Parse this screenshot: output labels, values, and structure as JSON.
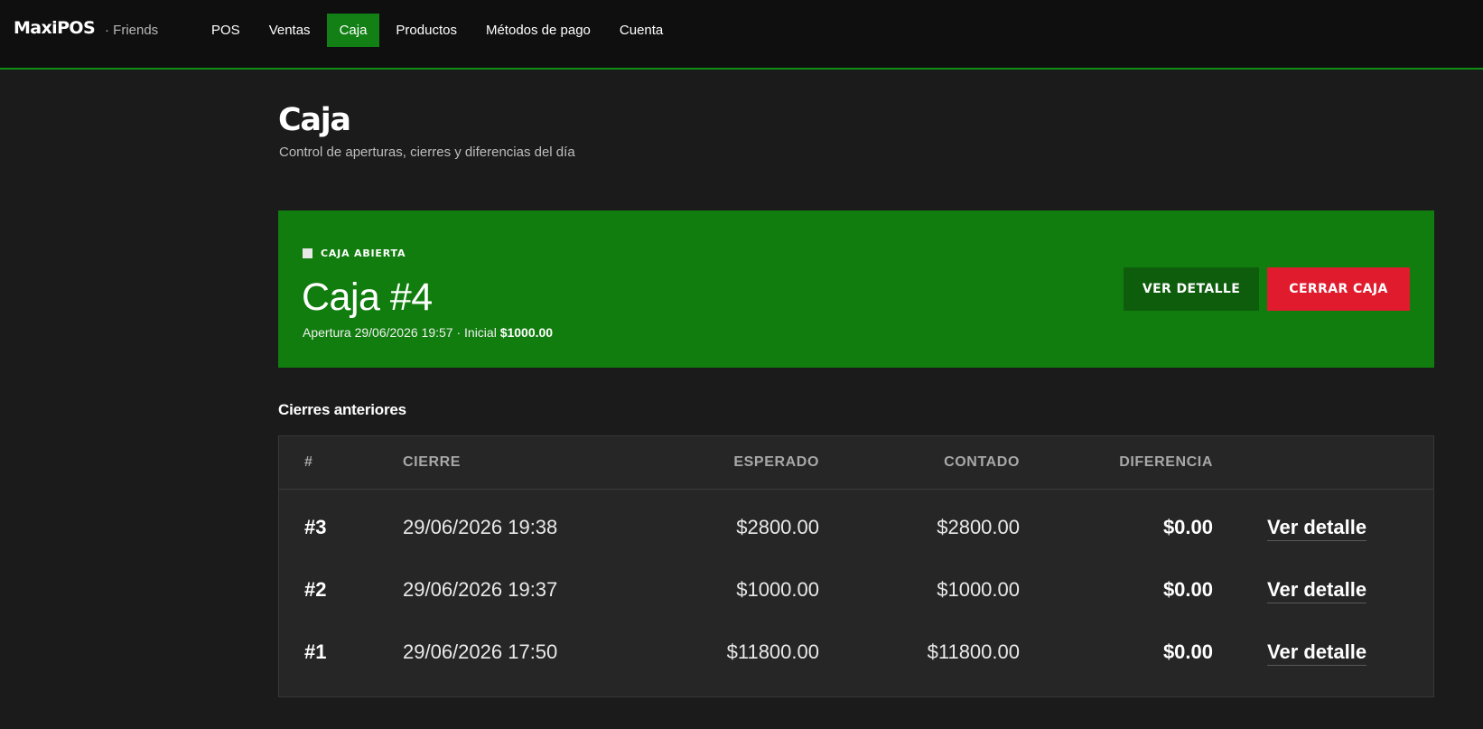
{
  "app": {
    "brand": "MaxiPOS",
    "store": "· Friends"
  },
  "nav": {
    "items": [
      "POS",
      "Ventas",
      "Caja",
      "Productos",
      "Métodos de pago",
      "Cuenta"
    ],
    "active": "Caja"
  },
  "page": {
    "title": "Caja",
    "subtitle": "Control de aperturas, cierres y diferencias del día"
  },
  "current_register": {
    "status_label": "CAJA ABIERTA",
    "title": "Caja #4",
    "opening_prefix": "Apertura 29/06/2026 19:57 · Inicial",
    "initial_amount": "$1000.00",
    "detail_button": "VER DETALLE",
    "close_button": "CERRAR CAJA",
    "card_color": "#117d0e",
    "close_color": "#e11b2e"
  },
  "closings": {
    "section_title": "Cierres anteriores",
    "columns": [
      "#",
      "CIERRE",
      "ESPERADO",
      "CONTADO",
      "DIFERENCIA"
    ],
    "rows": [
      {
        "id": "#3",
        "closed_at": "29/06/2026 19:38",
        "expected": "$2800.00",
        "counted": "$2800.00",
        "difference": "$0.00",
        "action": "Ver detalle"
      },
      {
        "id": "#2",
        "closed_at": "29/06/2026 19:37",
        "expected": "$1000.00",
        "counted": "$1000.00",
        "difference": "$0.00",
        "action": "Ver detalle"
      },
      {
        "id": "#1",
        "closed_at": "29/06/2026 17:50",
        "expected": "$11800.00",
        "counted": "$11800.00",
        "difference": "$0.00",
        "action": "Ver detalle"
      }
    ]
  }
}
